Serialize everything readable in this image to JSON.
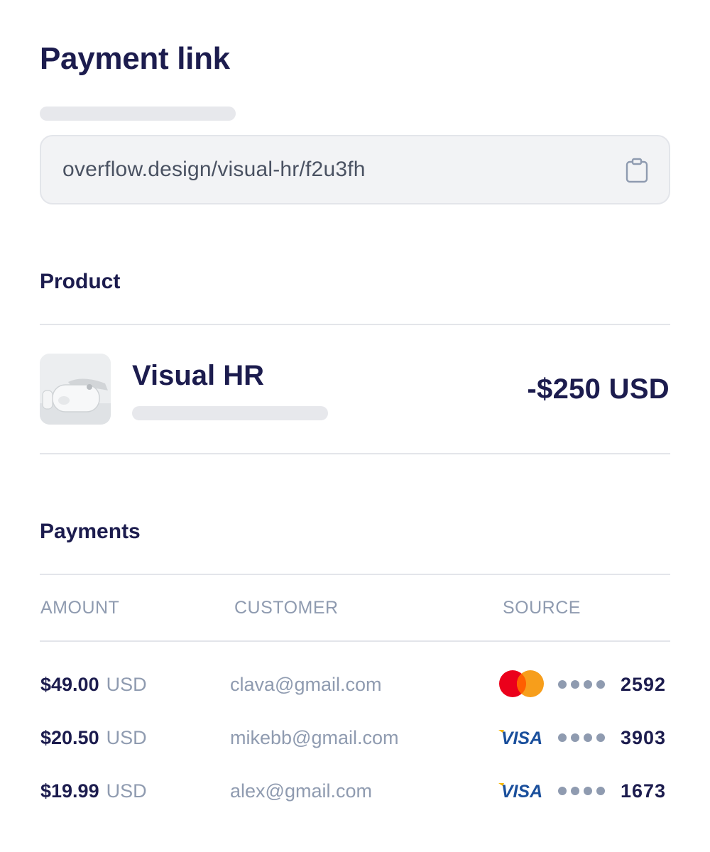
{
  "page": {
    "title": "Payment link"
  },
  "link": {
    "url": "overflow.design/visual-hr/f2u3fh",
    "copy_icon": "clipboard-icon"
  },
  "product": {
    "section_title": "Product",
    "name": "Visual HR",
    "price": "-$250 USD",
    "thumbnail_icon": "vr-headset-image"
  },
  "payments": {
    "section_title": "Payments",
    "columns": [
      "AMOUNT",
      "CUSTOMER",
      "SOURCE"
    ],
    "rows": [
      {
        "amount": "$49.00",
        "currency": "USD",
        "customer": "clava@gmail.com",
        "card_brand": "mastercard",
        "last4": "2592"
      },
      {
        "amount": "$20.50",
        "currency": "USD",
        "customer": "mikebb@gmail.com",
        "card_brand": "visa",
        "last4": "3903"
      },
      {
        "amount": "$19.99",
        "currency": "USD",
        "customer": "alex@gmail.com",
        "card_brand": "visa",
        "last4": "1673"
      }
    ]
  },
  "colors": {
    "text_primary": "#1c1c4e",
    "text_muted": "#8f9bb0",
    "field_bg": "#f2f3f5",
    "divider": "#e3e5ea",
    "visa_blue": "#1a4f9c",
    "mastercard_red": "#eb001b",
    "mastercard_orange": "#f79e1b"
  }
}
